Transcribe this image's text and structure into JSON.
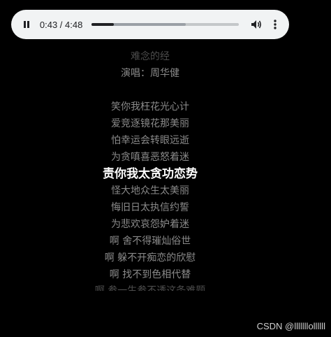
{
  "player": {
    "time": "0:43 / 4:48",
    "progress_fraction": 0.149,
    "buffered_fraction": 0.64
  },
  "lyrics": {
    "header_partial": "难念的经",
    "singer": "演唱：周华健",
    "lines": [
      "笑你我枉花光心计",
      "爱竞逐镜花那美丽",
      "怕幸运会转眼远逝",
      "为贪嗔喜恶怒着迷",
      "责你我太贪功恋势",
      "怪大地众生太美丽",
      "悔旧日太执信约誓",
      "为悲欢哀怨妒着迷",
      "啊 舍不得璀灿俗世",
      "啊 躲不开痴恋的欣慰",
      "啊 找不到色相代替",
      "啊 参一生参不透这条难题"
    ],
    "active_index": 4
  },
  "watermark": "CSDN @lllllllollllll"
}
